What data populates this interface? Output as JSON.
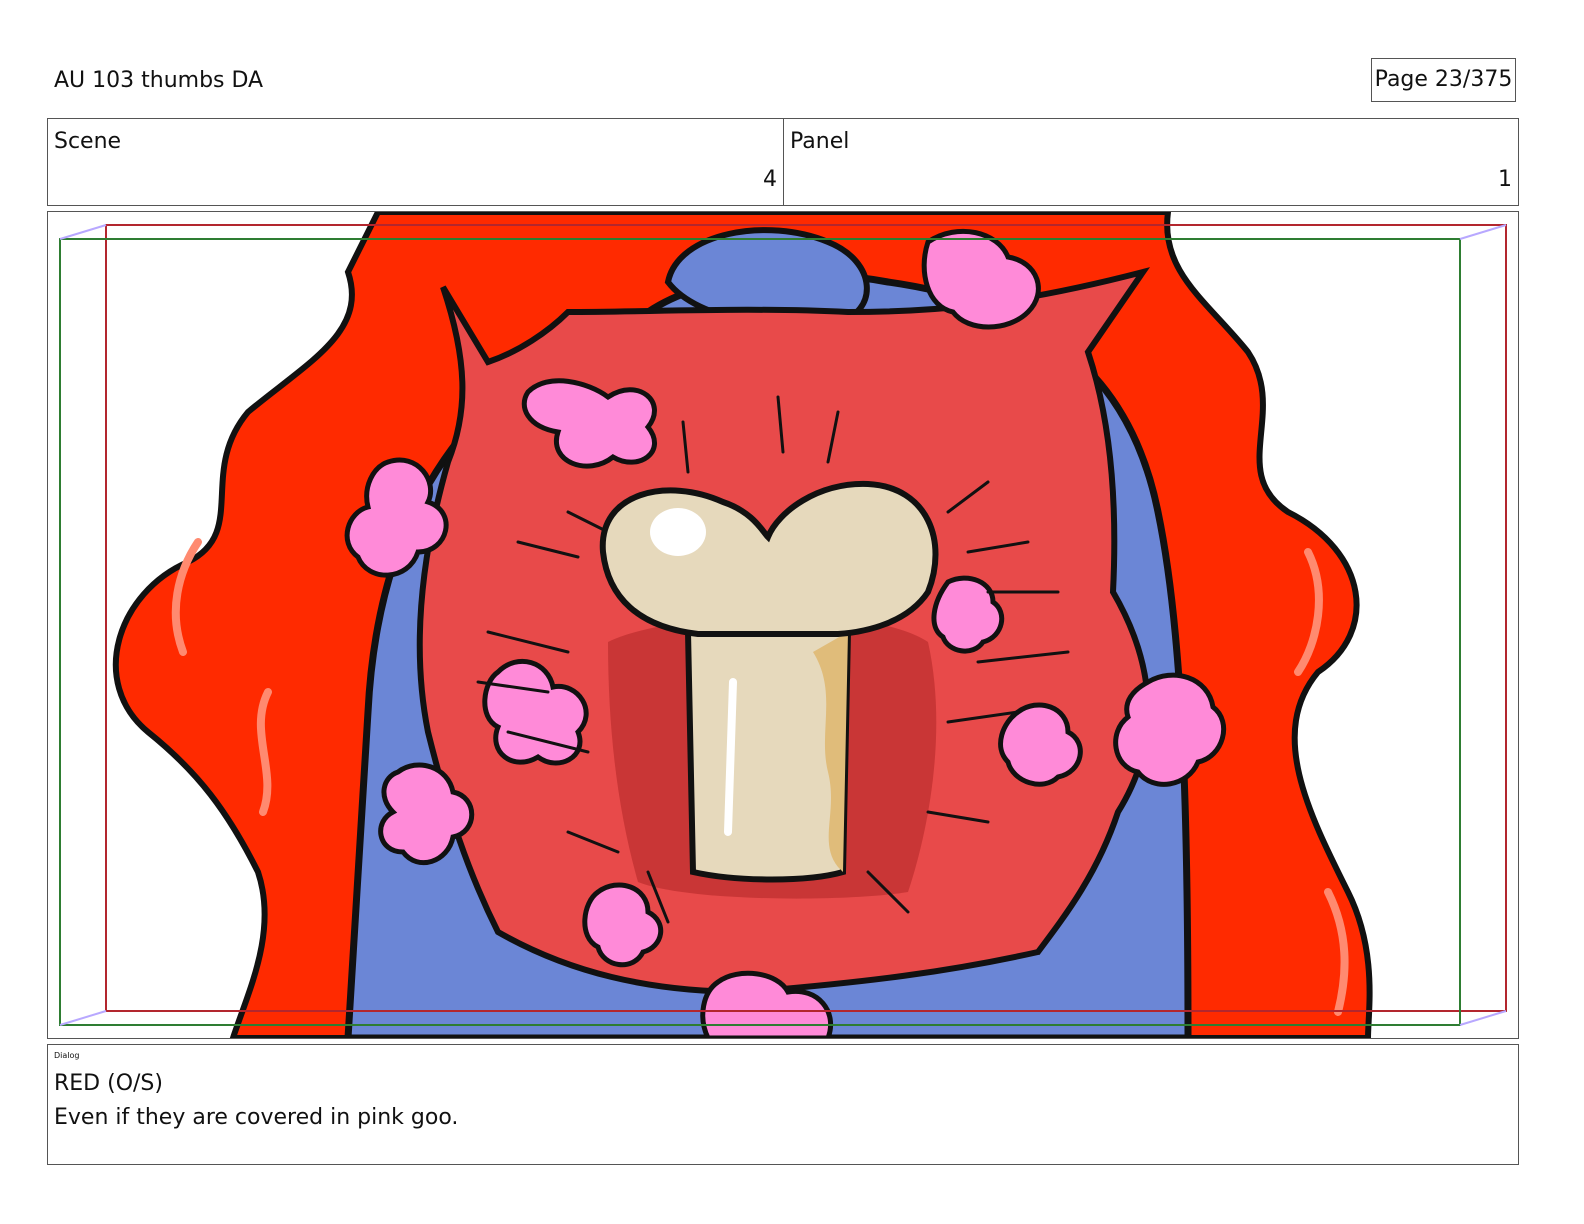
{
  "document": {
    "title": "AU 103 thumbs DA",
    "page_indicator": "Page  23/375"
  },
  "info": {
    "scene_label": "Scene",
    "scene_value": "4",
    "panel_label": "Panel",
    "panel_value": "1"
  },
  "dialog": {
    "label": "Dialog",
    "character": "RED (O/S)",
    "line": "Even if they are covered in pink goo."
  },
  "colors": {
    "goo_red": "#ff2a00",
    "mouth_red": "#e84a4a",
    "blue": "#6b86d6",
    "pink": "#ff8ad8",
    "bone": "#e6d9bc",
    "safe_frame_red": "#b3262e",
    "safe_frame_green": "#2e7d32"
  }
}
